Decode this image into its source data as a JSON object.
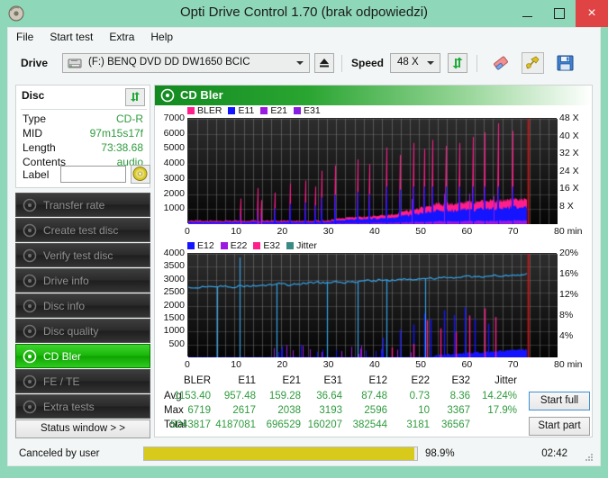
{
  "window": {
    "title": "Opti Drive Control 1.70 (brak odpowiedzi)",
    "icon": "disc-icon",
    "minimize": "minimize-icon",
    "maximize": "maximize-icon",
    "close": "×"
  },
  "menu": {
    "items": [
      {
        "label": "File"
      },
      {
        "label": "Start test"
      },
      {
        "label": "Extra"
      },
      {
        "label": "Help"
      }
    ]
  },
  "toolbar": {
    "drive_label": "Drive",
    "drive_value": "(F:)  BENQ DVD DD DW1650 BCIC",
    "eject_icon": "eject-icon",
    "speed_label": "Speed",
    "speed_value": "48 X",
    "refresh_icon": "refresh-icon",
    "eraser_icon": "eraser-icon",
    "tools_icon": "tools-icon",
    "save_icon": "save-icon"
  },
  "disc_panel": {
    "heading": "Disc",
    "refresh_icon": "refresh-icon",
    "rows": [
      {
        "key": "Type",
        "value": "CD-R"
      },
      {
        "key": "MID",
        "value": "97m15s17f"
      },
      {
        "key": "Length",
        "value": "73:38.68"
      },
      {
        "key": "Contents",
        "value": "audio"
      }
    ],
    "label_key": "Label",
    "label_value": "",
    "label_placeholder": "",
    "label_disc_icon": "cd-disc-icon"
  },
  "sidebar": {
    "items": [
      {
        "label": "Transfer rate",
        "icon": "disc-icon",
        "active": false
      },
      {
        "label": "Create test disc",
        "icon": "disc-write-icon",
        "active": false
      },
      {
        "label": "Verify test disc",
        "icon": "disc-check-icon",
        "active": false
      },
      {
        "label": "Drive info",
        "icon": "drive-icon",
        "active": false
      },
      {
        "label": "Disc info",
        "icon": "disc-info-icon",
        "active": false
      },
      {
        "label": "Disc quality",
        "icon": "disc-quality-icon",
        "active": false
      },
      {
        "label": "CD Bler",
        "icon": "disc-bler-icon",
        "active": true
      },
      {
        "label": "FE / TE",
        "icon": "disc-fete-icon",
        "active": false
      },
      {
        "label": "Extra tests",
        "icon": "disc-extra-icon",
        "active": false
      }
    ],
    "status_window": "Status window > >"
  },
  "panel": {
    "title": "CD Bler",
    "icon": "disc-bler-icon"
  },
  "buttons": {
    "start_full": "Start full",
    "start_part": "Start part"
  },
  "statusbar": {
    "message": "Canceled by user",
    "percent_label": "98.9%",
    "percent_value": 98.9,
    "time": "02:42"
  },
  "colors": {
    "bler": "#ff1e8c",
    "e11": "#1414ff",
    "e21": "#9b19e0",
    "e31": "#8a1ee0",
    "e12": "#1414ff",
    "e22": "#9b19e0",
    "e32": "#ff1e8c",
    "jitter": "#3a8a86",
    "jitter_trace": "#35a3e8",
    "marker": "#e01010",
    "accent_green": "#2f9b3e",
    "progress": "#d8ca1b",
    "title_bg": "#8ed7b8",
    "close_bg": "#e04343"
  },
  "chart_data": [
    {
      "type": "area",
      "name": "cd-bler-chart",
      "title": "CD Bler",
      "xlabel": "min",
      "ylabel": "",
      "xlim": [
        0,
        80
      ],
      "ylim": [
        0,
        7000
      ],
      "xticks": [
        0,
        10,
        20,
        30,
        40,
        50,
        60,
        70,
        80
      ],
      "xtick_labels": [
        "0",
        "10",
        "20",
        "30",
        "40",
        "50",
        "60",
        "70",
        "80 min"
      ],
      "yticks": [
        1000,
        2000,
        3000,
        4000,
        5000,
        6000,
        7000
      ],
      "right_axis": {
        "label": "X",
        "ylim": [
          0,
          48
        ],
        "ticks": [
          8,
          16,
          24,
          32,
          40,
          48
        ],
        "tick_labels": [
          "8 X",
          "16 X",
          "24 X",
          "32 X",
          "40 X",
          "48 X"
        ]
      },
      "grid": true,
      "legend": [
        "BLER",
        "E11",
        "E21",
        "E31"
      ],
      "legend_position": "top-left",
      "data_end_min": 73.6,
      "marker_line_min": 73.6,
      "series": [
        {
          "name": "BLER",
          "color": "#ff1e8c",
          "avg": 1153.4,
          "max": 6719,
          "total": "5043817"
        },
        {
          "name": "E11",
          "color": "#1414ff",
          "avg": 957.48,
          "max": 2617,
          "total": "4187081"
        },
        {
          "name": "E21",
          "color": "#9b19e0",
          "avg": 159.28,
          "max": 2038,
          "total": "696529"
        },
        {
          "name": "E31",
          "color": "#8a1ee0",
          "avg": 36.64,
          "max": 3193,
          "total": "160207"
        }
      ]
    },
    {
      "type": "line",
      "name": "cd-jitter-chart",
      "xlabel": "min",
      "ylabel": "",
      "xlim": [
        0,
        80
      ],
      "ylim": [
        0,
        4000
      ],
      "xticks": [
        0,
        10,
        20,
        30,
        40,
        50,
        60,
        70,
        80
      ],
      "xtick_labels": [
        "0",
        "10",
        "20",
        "30",
        "40",
        "50",
        "60",
        "70",
        "80 min"
      ],
      "yticks": [
        500,
        1000,
        1500,
        2000,
        2500,
        3000,
        3500,
        4000
      ],
      "right_axis": {
        "label": "%",
        "ylim": [
          0,
          20
        ],
        "ticks": [
          4,
          8,
          12,
          16,
          20
        ],
        "tick_labels": [
          "4%",
          "8%",
          "12%",
          "16%",
          "20%"
        ]
      },
      "grid": true,
      "legend": [
        "E12",
        "E22",
        "E32",
        "Jitter"
      ],
      "legend_position": "top-left",
      "data_end_min": 73.6,
      "marker_line_min": 73.6,
      "series": [
        {
          "name": "E12",
          "color": "#1414ff",
          "avg": 87.48,
          "max": 2596,
          "total": "382544"
        },
        {
          "name": "E22",
          "color": "#9b19e0",
          "avg": 0.73,
          "max": 10,
          "total": "3181"
        },
        {
          "name": "E32",
          "color": "#ff1e8c",
          "avg": 8.36,
          "max": 3367,
          "total": "36567"
        },
        {
          "name": "Jitter",
          "color": "#3a8a86",
          "avg": "14.24%",
          "max": "17.9%",
          "total": ""
        }
      ]
    }
  ],
  "stats_table": {
    "type": "table",
    "columns": [
      "",
      "BLER",
      "E11",
      "E21",
      "E31",
      "E12",
      "E22",
      "E32",
      "Jitter"
    ],
    "rows": [
      {
        "label": "Avg",
        "values": [
          "1153.40",
          "957.48",
          "159.28",
          "36.64",
          "87.48",
          "0.73",
          "8.36",
          "14.24%"
        ]
      },
      {
        "label": "Max",
        "values": [
          "6719",
          "2617",
          "2038",
          "3193",
          "2596",
          "10",
          "3367",
          "17.9%"
        ]
      },
      {
        "label": "Total",
        "values": [
          "5043817",
          "4187081",
          "696529",
          "160207",
          "382544",
          "3181",
          "36567",
          ""
        ]
      }
    ]
  }
}
